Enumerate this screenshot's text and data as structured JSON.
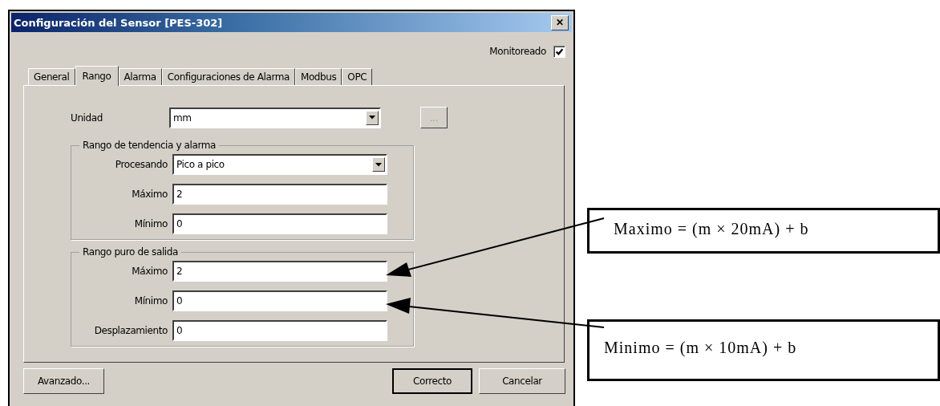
{
  "window": {
    "title": "Configuración del Sensor [PES-302]",
    "close": "✕"
  },
  "monitored": {
    "label": "Monitoreado",
    "checked": true
  },
  "tabs": [
    {
      "label": "General",
      "selected": false
    },
    {
      "label": "Rango",
      "selected": true
    },
    {
      "label": "Alarma",
      "selected": false
    },
    {
      "label": "Configuraciones de Alarma",
      "selected": false
    },
    {
      "label": "Modbus",
      "selected": false
    },
    {
      "label": "OPC",
      "selected": false
    }
  ],
  "unit": {
    "label": "Unidad",
    "value": "mm",
    "kind": "dropdown"
  },
  "unit_button": {
    "label": "...",
    "disabled": true
  },
  "groups": [
    {
      "title": "Rango de tendencia y alarma",
      "fields": [
        {
          "label": "Procesando",
          "value": "Pico a pico",
          "kind": "dropdown"
        },
        {
          "label": "Máximo",
          "value": "2",
          "kind": "text"
        },
        {
          "label": "Mínimo",
          "value": "0",
          "kind": "text"
        }
      ]
    },
    {
      "title": "Rango puro de salida",
      "fields": [
        {
          "label": "Máximo",
          "value": "2",
          "kind": "text"
        },
        {
          "label": "Mínimo",
          "value": "0",
          "kind": "text"
        },
        {
          "label": "Desplazamiento",
          "value": "0",
          "kind": "text"
        }
      ]
    }
  ],
  "buttons": [
    {
      "label": "Avanzado...",
      "default": false
    },
    {
      "label": "Correcto",
      "default": true
    },
    {
      "label": "Cancelar",
      "default": false
    }
  ],
  "annotations": [
    {
      "text": "Maximo = (m × 20mA) + b"
    },
    {
      "text": "Minimo = (m × 10mA) + b"
    }
  ]
}
